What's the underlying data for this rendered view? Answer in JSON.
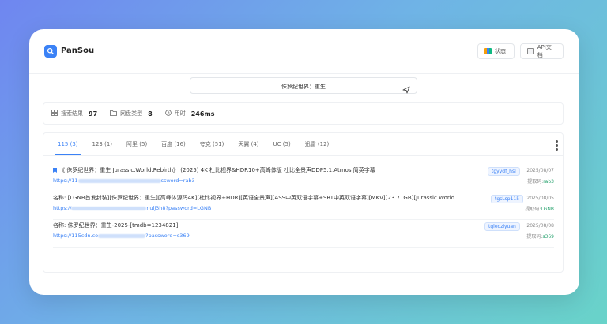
{
  "app": {
    "name": "PanSou"
  },
  "header": {
    "status_label": "状态",
    "api_label": "API文档"
  },
  "search": {
    "query": "侏罗纪世界：重生"
  },
  "stats": {
    "results_label": "搜索结果",
    "results_value": "97",
    "types_label": "网盘类型",
    "types_value": "8",
    "time_label": "用时",
    "time_value": "246ms"
  },
  "tabs": [
    {
      "label": "115 (3)"
    },
    {
      "label": "123 (1)"
    },
    {
      "label": "阿里 (5)"
    },
    {
      "label": "百度 (16)"
    },
    {
      "label": "夸克 (51)"
    },
    {
      "label": "天翼 (4)"
    },
    {
      "label": "UC (5)"
    },
    {
      "label": "迅雷 (12)"
    }
  ],
  "results": [
    {
      "title": "《 侏罗纪世界：重生 Jurassic.World.Rebirth》 (2025) 4K 杜比视界&HDR10+高峰体版 杜比全景声DDP5.1.Atmos 简英字幕",
      "link_prefix": "https://11",
      "link_suffix": "ssword=rab3",
      "tag": "tgyydf_hsl",
      "date": "2025/08/07",
      "code_label": "提取码:",
      "code": "rab3"
    },
    {
      "title": "名称: [LGNB首发封装][侏罗纪世界：重生][高峰体源码4K][杜比视界+HDR][英语全景声][ASS中英双语字幕+SRT中英双语字幕][MKV][23.71GB][Jurassic.World...",
      "link_prefix": "https://",
      "link_suffix": "nulj3h8?password=LGNB",
      "tag": "tgsLsp115",
      "date": "2025/08/05",
      "code_label": "提取码:",
      "code": "LGNB"
    },
    {
      "title": "名称: 侏罗纪世界：重生-2025-[tmdb=1234821]",
      "link_prefix": "https://115cdn.co",
      "link_suffix": "?password=s369",
      "tag": "tgleoziyuan",
      "date": "2025/08/08",
      "code_label": "提取码:",
      "code": "s369"
    }
  ],
  "colors": {
    "accent": "#3b82f6",
    "code_green": "#22a06b"
  }
}
